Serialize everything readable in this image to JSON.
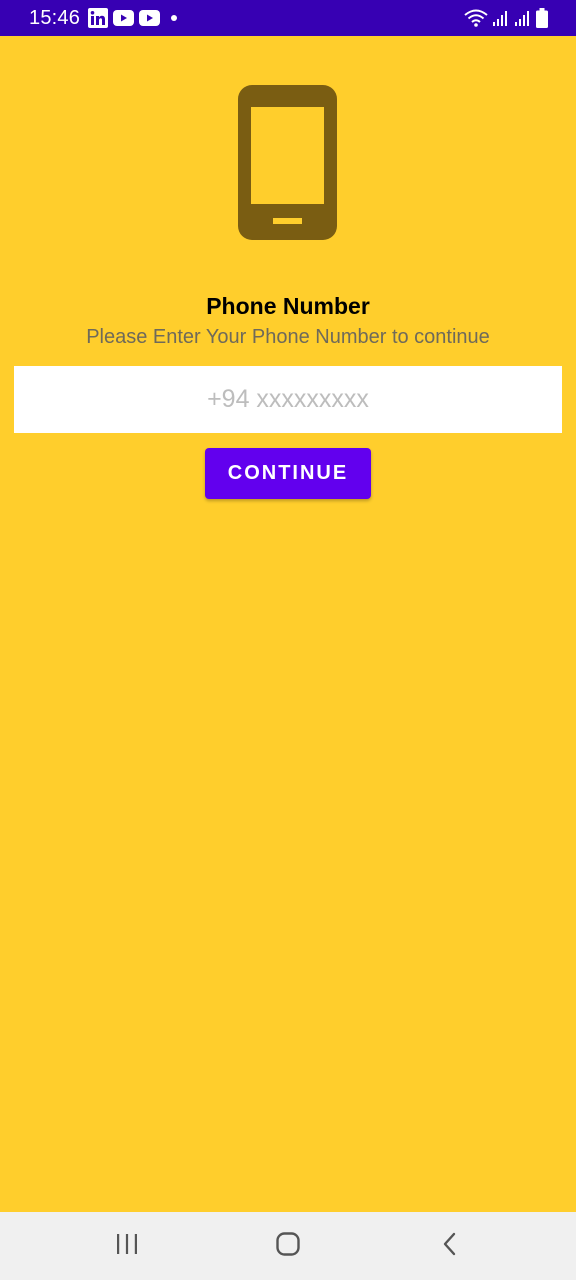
{
  "status_bar": {
    "time": "15:46",
    "notification_icons": [
      "linkedin-icon",
      "youtube-icon",
      "youtube-icon",
      "dot-icon"
    ],
    "system_icons": [
      "wifi-icon",
      "signal-icon",
      "signal-icon",
      "battery-icon"
    ],
    "background_color": "#3700B3"
  },
  "main": {
    "background_color": "#FFCE2C",
    "icon": "smartphone-icon",
    "title": "Phone Number",
    "subtitle": "Please Enter Your Phone Number to continue",
    "phone_input": {
      "value": "",
      "placeholder": "+94 xxxxxxxxx"
    },
    "continue_label": "CONTINUE",
    "accent_color": "#6200EE"
  },
  "nav_bar": {
    "buttons": [
      "recents-icon",
      "home-icon",
      "back-icon"
    ]
  }
}
